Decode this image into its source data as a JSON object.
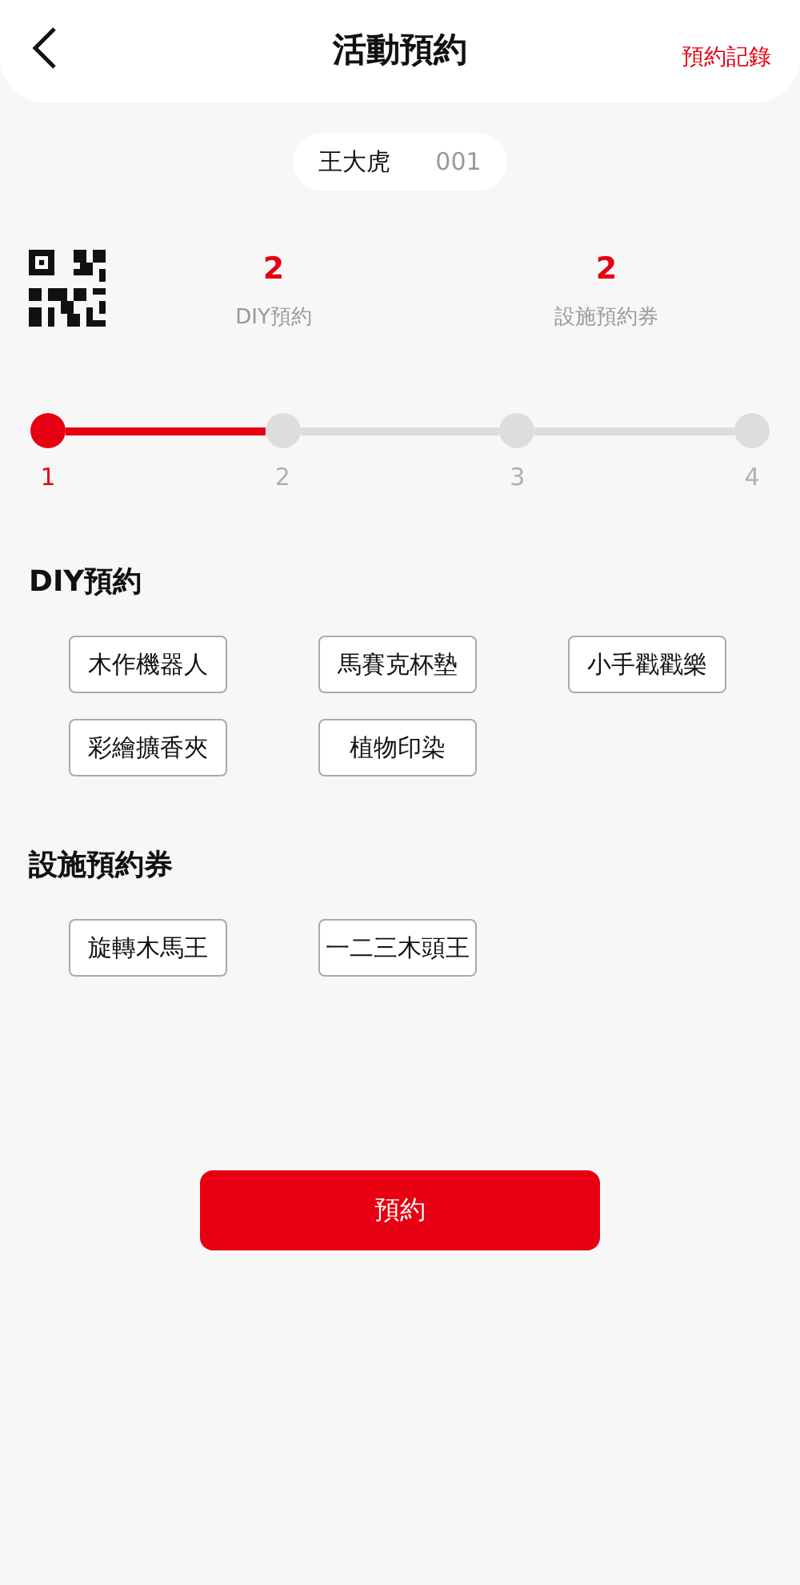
{
  "header": {
    "title": "活動預約",
    "link": "預約記錄"
  },
  "user": {
    "name": "王大虎",
    "number": "001"
  },
  "stats": [
    {
      "value": "2",
      "label": "DIY預約"
    },
    {
      "value": "2",
      "label": "設施預約券"
    }
  ],
  "steps": [
    {
      "label": "1",
      "selected": true
    },
    {
      "label": "2",
      "selected": false
    },
    {
      "label": "3",
      "selected": false
    },
    {
      "label": "4",
      "selected": false
    }
  ],
  "sections": [
    {
      "title": "DIY預約",
      "options": [
        "木作機器人",
        "馬賽克杯墊",
        "小手戳戳樂",
        "彩繪擴香夾",
        "植物印染"
      ]
    },
    {
      "title": "設施預約券",
      "options": [
        "旋轉木馬王",
        "一二三木頭王"
      ]
    }
  ],
  "submit": "預約"
}
